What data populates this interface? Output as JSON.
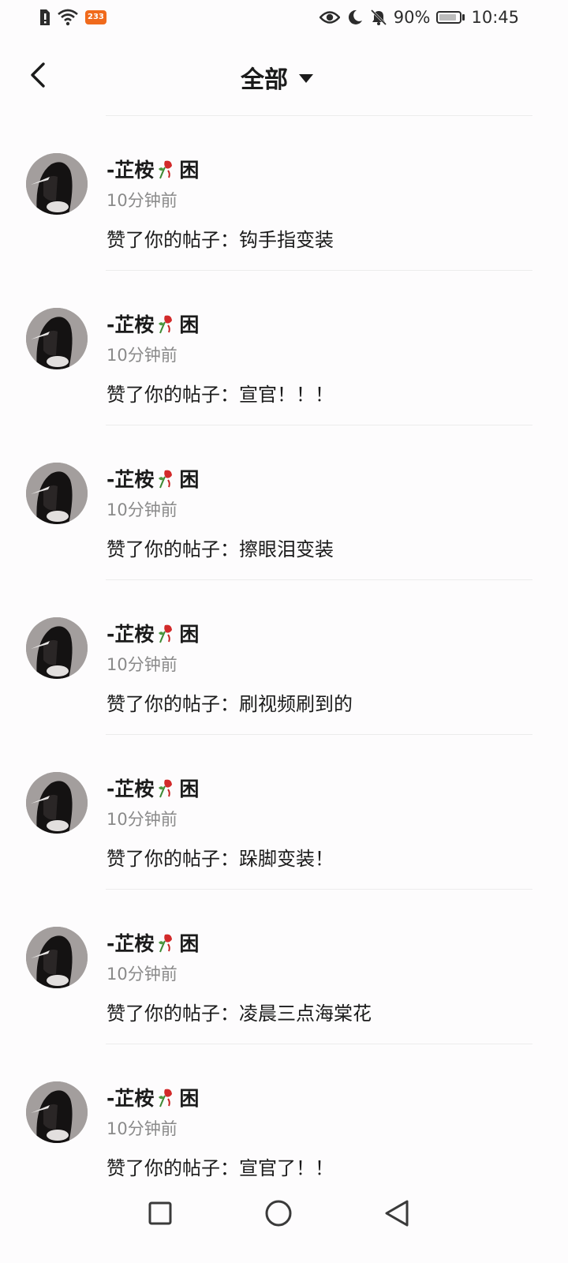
{
  "status_bar": {
    "badge": "233",
    "battery": "90%",
    "time": "10:45",
    "icons": [
      "sim-alert-icon",
      "wifi-icon",
      "app-badge-icon",
      "eye-icon",
      "moon-icon",
      "bell-off-icon",
      "battery-icon"
    ]
  },
  "header": {
    "title": "全部",
    "back_icon": "chevron-left-icon",
    "dropdown_icon": "caret-down-icon"
  },
  "notifications": [
    {
      "user": "-芷桉",
      "suffix": "困",
      "time": "10分钟前",
      "action": "赞了你的帖子：",
      "post": "钩手指变装"
    },
    {
      "user": "-芷桉",
      "suffix": "困",
      "time": "10分钟前",
      "action": "赞了你的帖子：",
      "post": "宣官！！！"
    },
    {
      "user": "-芷桉",
      "suffix": "困",
      "time": "10分钟前",
      "action": "赞了你的帖子：",
      "post": "擦眼泪变装"
    },
    {
      "user": "-芷桉",
      "suffix": "困",
      "time": "10分钟前",
      "action": "赞了你的帖子：",
      "post": "刷视频刷到的"
    },
    {
      "user": "-芷桉",
      "suffix": "困",
      "time": "10分钟前",
      "action": "赞了你的帖子：",
      "post": "跺脚变装！"
    },
    {
      "user": "-芷桉",
      "suffix": "困",
      "time": "10分钟前",
      "action": "赞了你的帖子：",
      "post": "凌晨三点海棠花"
    },
    {
      "user": "-芷桉",
      "suffix": "困",
      "time": "10分钟前",
      "action": "赞了你的帖子：",
      "post": "宣官了！！"
    }
  ],
  "nav_bar": {
    "icons": [
      "recents-square-icon",
      "home-circle-icon",
      "back-triangle-icon"
    ]
  }
}
